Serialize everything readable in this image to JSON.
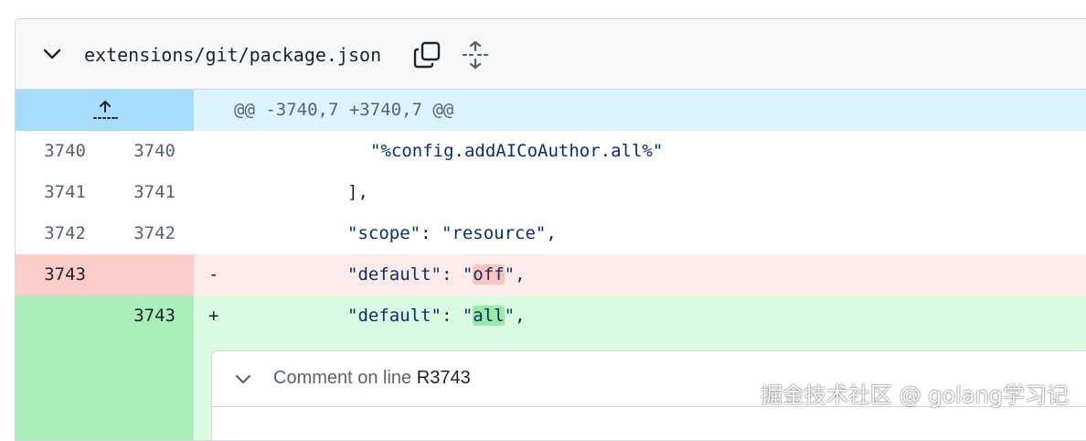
{
  "file": {
    "path": "extensions/git/package.json",
    "collapse_icon": "chevron-down-icon",
    "copy_icon": "copy-icon",
    "expand_icon": "unfold-icon"
  },
  "diff": {
    "hunk_header": "@@ -3740,7 +3740,7 @@",
    "expand_up_icon": "expand-up-icon",
    "lines": [
      {
        "type": "context",
        "old": "3740",
        "new": "3740",
        "marker": "",
        "text": "\"%config.addAICoAuthor.all%\""
      },
      {
        "type": "context",
        "old": "3741",
        "new": "3741",
        "marker": "",
        "text": "],"
      },
      {
        "type": "context",
        "old": "3742",
        "new": "3742",
        "marker": "",
        "key": "\"scope\"",
        "sep": ": ",
        "value": "\"resource\"",
        "tail": ","
      },
      {
        "type": "deletion",
        "old": "3743",
        "new": "",
        "marker": "-",
        "key": "\"default\"",
        "sep": ": ",
        "q1": "\"",
        "hl": "off",
        "q2": "\"",
        "tail": ","
      },
      {
        "type": "addition",
        "old": "",
        "new": "3743",
        "marker": "+",
        "key": "\"default\"",
        "sep": ": ",
        "q1": "\"",
        "hl": "all",
        "q2": "\"",
        "tail": ","
      }
    ]
  },
  "comment": {
    "prefix": "Comment on line ",
    "line_ref": "R3743",
    "chevron_icon": "chevron-down-icon"
  },
  "watermark": "掘金技术社区 @ golang学习记",
  "colors": {
    "hunk_gutter": "#a8dcfc",
    "hunk_bg": "#ddf4ff",
    "del_num_bg": "#ffcecb",
    "del_bg": "#ffebe9",
    "add_num_bg": "#aceebb",
    "add_bg": "#dafbe1",
    "string": "#0a3069"
  }
}
